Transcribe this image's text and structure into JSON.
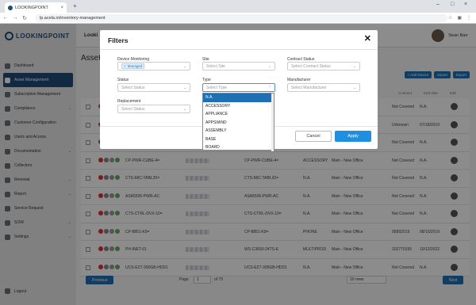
{
  "browser": {
    "tab_title": "LOOKINGPOINT",
    "url": "lp.acela.io/inventory-management"
  },
  "sidebar": {
    "brand": "LOOKINGPOINT",
    "items": [
      {
        "label": "Dashboard",
        "chevron": false
      },
      {
        "label": "Asset Management",
        "chevron": false
      },
      {
        "label": "Subscription Management",
        "chevron": false
      },
      {
        "label": "Compliance",
        "chevron": true
      },
      {
        "label": "Customer Configuration",
        "chevron": false
      },
      {
        "label": "Users and Access",
        "chevron": false
      },
      {
        "label": "Documentation",
        "chevron": true
      },
      {
        "label": "Collectors",
        "chevron": false
      },
      {
        "label": "Renewal",
        "chevron": true
      },
      {
        "label": "Report",
        "chevron": true
      },
      {
        "label": "Service Request",
        "chevron": false
      },
      {
        "label": "SOW",
        "chevron": true
      },
      {
        "label": "Settings",
        "chevron": true
      }
    ],
    "logout": "Logout"
  },
  "header": {
    "brand": "Looki",
    "user_name": "Sean Barr"
  },
  "page": {
    "title": "Asset",
    "actions": [
      "+ Add Device",
      "Import",
      "Export"
    ]
  },
  "table": {
    "headers": [
      "Contract",
      "End date",
      "Edit"
    ],
    "rows": [
      {
        "name": "",
        "model": "",
        "type": "",
        "site": "",
        "contract": "Not Covered",
        "end": "N.A."
      },
      {
        "name": "",
        "model": "",
        "type": "",
        "site": "",
        "contract": "Unknown",
        "end": "07/18/2019"
      },
      {
        "name": "",
        "model": "",
        "type": "",
        "site": "",
        "contract": "Not Covered",
        "end": "N.A."
      },
      {
        "name": "CP-PWR-CUBE-4=",
        "model": "CP-PWR-CUBE-4=",
        "type": "ACCESSORY",
        "site": "Main - New Office",
        "contract": "Not Covered",
        "end": "N.A."
      },
      {
        "name": "CTS-MIC-TABL20=",
        "model": "CTS-MIC-TABL20=",
        "type": "N.A.",
        "site": "Main - New Office",
        "contract": "Not Covered",
        "end": "N.A."
      },
      {
        "name": "ASA5506-PWR-AC",
        "model": "ASA5506-PWR-AC",
        "type": "N.A.",
        "site": "Main - New Office",
        "contract": "Not Covered",
        "end": "N.A."
      },
      {
        "name": "CTS-CTRL-DVX-10=",
        "model": "CTS-CTRL-DVX-10=",
        "type": "N.A.",
        "site": "Main - New Office",
        "contract": "Not Covered",
        "end": "N.A."
      },
      {
        "name": "CP-8851-K9=",
        "model": "CP-8851-K9=",
        "type": "PHONE",
        "site": "Main - New Office",
        "contract": "95892019",
        "end": "08/10/2019"
      },
      {
        "name": "PH-INET-01",
        "model": "WS-C3650-24TS-E",
        "type": "MULTIPROD",
        "site": "Main - New Office",
        "contract": "202770155",
        "end": "10/12/2022"
      },
      {
        "name": "UCS-EZ7-300GB-HDD1",
        "model": "UCS-EZ7-300GB-HDD1",
        "type": "N.A.",
        "site": "Main - New Office",
        "contract": "Not Covered",
        "end": "N.A."
      }
    ]
  },
  "pagination": {
    "previous": "Previous",
    "page_label": "Page",
    "page_value": "1",
    "of_label": "of 75",
    "rows_select": "10 rows",
    "next": "Next"
  },
  "modal": {
    "title": "Filters",
    "fields": {
      "device_monitoring": {
        "label": "Device Monitoring",
        "chip": "Managed"
      },
      "site": {
        "label": "Site",
        "placeholder": "Select Site"
      },
      "contract_status": {
        "label": "Contract Status",
        "placeholder": "Select Contract Status"
      },
      "status": {
        "label": "Status",
        "placeholder": "Select Status"
      },
      "type": {
        "label": "Type",
        "placeholder": "Select Type"
      },
      "manufacturer": {
        "label": "Manufacturer",
        "placeholder": "Select Manufacturer"
      },
      "replacement": {
        "label": "Replacement",
        "placeholder": "Select Status"
      }
    },
    "type_options": [
      "N.A.",
      "ACCESSORY",
      "APPLIANCE",
      "APPSWIND",
      "ASSEMBLY",
      "BASE",
      "BOARD"
    ],
    "type_highlighted": "N.A.",
    "cancel": "Cancel",
    "apply": "Apply"
  }
}
